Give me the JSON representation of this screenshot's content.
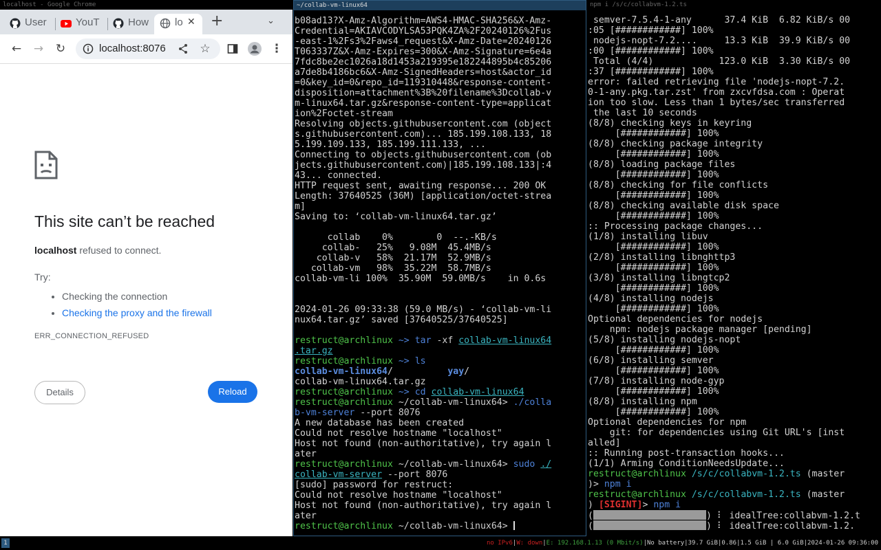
{
  "chrome": {
    "window_title": "localhost - Google Chrome",
    "tabs": [
      {
        "label": "User",
        "icon": "github-icon"
      },
      {
        "label": "YouT",
        "icon": "youtube-icon"
      },
      {
        "label": "How",
        "icon": "github-icon"
      },
      {
        "label": "lo",
        "icon": "globe-icon",
        "active": true
      }
    ],
    "url": "localhost:8076",
    "error": {
      "title": "This site can’t be reached",
      "host": "localhost",
      "desc_rest": " refused to connect.",
      "try_label": "Try:",
      "suggestion_1": "Checking the connection",
      "suggestion_2": "Checking the proxy and the firewall",
      "code": "ERR_CONNECTION_REFUSED",
      "details_button": "Details",
      "reload_button": "Reload"
    },
    "colors": {
      "link": "#1a73e8",
      "reload_bg": "#1a73e8"
    }
  },
  "term1": {
    "title": "~/collab-vm-linux64",
    "lines": [
      "b08ad13?X-Amz-Algorithm=AWS4-HMAC-SHA256&X-Amz-",
      "Credential=AKIAVCODYLSA53PQK4ZA%2F20240126%2Fus",
      "-east-1%2Fs3%2Faws4_request&X-Amz-Date=20240126",
      "T063337Z&X-Amz-Expires=300&X-Amz-Signature=6e4a",
      "7fdc8be2ec1026a18d1453a219395e182244895b4c85206",
      "a7de8b4186bc6&X-Amz-SignedHeaders=host&actor_id",
      "=0&key_id=0&repo_id=119310448&response-content-",
      "disposition=attachment%3B%20filename%3Dcollab-v",
      "m-linux64.tar.gz&response-content-type=applicat",
      "ion%2Foctet-stream",
      "Resolving objects.githubusercontent.com (object",
      "s.githubusercontent.com)... 185.199.108.133, 18",
      "5.199.109.133, 185.199.111.133, ...",
      "Connecting to objects.githubusercontent.com (ob",
      "jects.githubusercontent.com)|185.199.108.133|:4",
      "43... connected.",
      "HTTP request sent, awaiting response... 200 OK",
      "Length: 37640525 (36M) [application/octet-strea",
      "m]",
      "Saving to: ‘collab-vm-linux64.tar.gz’",
      "",
      "      collab    0%        0  --.-KB/s",
      "     collab-   25%   9.08M  45.4MB/s",
      "    collab-v   58%  21.17M  52.9MB/s",
      "   collab-vm   98%  35.22M  58.7MB/s",
      "collab-vm-li 100%  35.90M  59.0MB/s    in 0.6s",
      "",
      "",
      "2024-01-26 09:33:38 (59.0 MB/s) - ‘collab-vm-li",
      "nux64.tar.gz’ saved [37640525/37640525]",
      ""
    ],
    "user": "restruct@archlinux",
    "prompt_home": " ~> ",
    "prompt_dir": " ~/collab-vm-linux64> ",
    "tar_cmd": "tar",
    "tar_args": " -xf ",
    "tar_file_a": "collab-vm-linux64",
    "tar_file_b": ".tar.gz",
    "ls_cmd": "ls",
    "ls_dir1": "collab-vm-linux64",
    "ls_sep": "/          ",
    "ls_dir2": "yay",
    "ls_slash": "/",
    "ls_file": "collab-vm-linux64.tar.gz",
    "cd_cmd": "cd",
    "cd_arg": "collab-vm-linux64",
    "run1_cmd_a": "./colla",
    "run1_cmd_b": "b-vm-server",
    "run_args": " --port 8076",
    "out1": "A new database has been created",
    "out2": "Could not resolve hostname \"localhost\"",
    "out3": "Host not found (non-authoritative), try again l",
    "out4": "ater",
    "sudo_cmd": "sudo",
    "sudo_path_a": "./",
    "sudo_path_b": "collab-vm-server",
    "sudo_prompt": "[sudo] password for restruct:"
  },
  "term2": {
    "title": "npm i /s/c/collabvm-1.2.ts",
    "lines": [
      " semver-7.5.4-1-any      37.4 KiB  6.82 KiB/s 00",
      ":05 [############] 100%",
      " nodejs-nopt-7.2....     13.3 KiB  39.9 KiB/s 00",
      ":00 [############] 100%",
      " Total (4/4)            123.0 KiB  3.30 KiB/s 00",
      ":37 [############] 100%",
      "error: failed retrieving file 'nodejs-nopt-7.2.",
      "0-1-any.pkg.tar.zst' from zxcvfdsa.com : Operat",
      "ion too slow. Less than 1 bytes/sec transferred",
      " the last 10 seconds",
      "(8/8) checking keys in keyring",
      "     [############] 100%",
      "(8/8) checking package integrity",
      "     [############] 100%",
      "(8/8) loading package files",
      "     [############] 100%",
      "(8/8) checking for file conflicts",
      "     [############] 100%",
      "(8/8) checking available disk space",
      "     [############] 100%",
      ":: Processing package changes...",
      "(1/8) installing libuv",
      "     [############] 100%",
      "(2/8) installing libnghttp3",
      "     [############] 100%",
      "(3/8) installing libngtcp2",
      "     [############] 100%",
      "(4/8) installing nodejs",
      "     [############] 100%",
      "Optional dependencies for nodejs",
      "    npm: nodejs package manager [pending]",
      "(5/8) installing nodejs-nopt",
      "     [############] 100%",
      "(6/8) installing semver",
      "     [############] 100%",
      "(7/8) installing node-gyp",
      "     [############] 100%",
      "(8/8) installing npm",
      "     [############] 100%",
      "Optional dependencies for npm",
      "    git: for dependencies using Git URL's [inst",
      "alled]",
      ":: Running post-transaction hooks...",
      "(1/1) Arming ConditionNeedsUpdate..."
    ],
    "user": "restruct@archlinux",
    "path": " /s/c/collabvm-1.2.ts",
    "branch": " (master",
    "cont": ")> ",
    "npm_cmd": "npm i",
    "sig_open": " [",
    "sigint": "SIGINT",
    "sig_close": "]",
    "sig_arrow": "> ",
    "progress1": " ⠇ idealTree:collabvm-1.2.t",
    "progress2": " ⠇ idealTree:collabvm-1.2."
  },
  "statusbar": {
    "workspace": "1",
    "ipv6": "no IPv6",
    "wifi": "W: down",
    "eth": "E: 192.168.1.13 (0 Mbit/s)",
    "battery": "No battery",
    "disk": "39.7 GiB",
    "load": "0.86",
    "mem": "1.5 GiB",
    "swap": "6.0 GiB",
    "datetime": "2024-01-26 09:36:00"
  }
}
